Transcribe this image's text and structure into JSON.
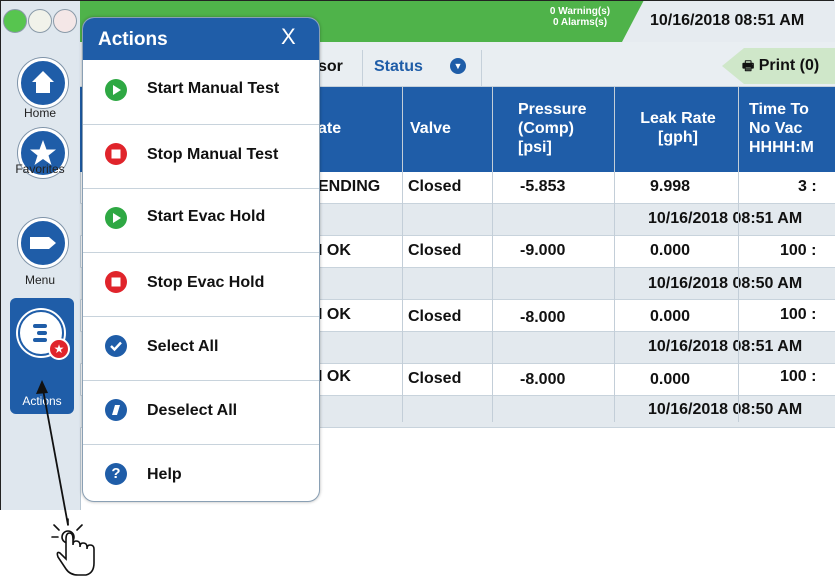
{
  "status": {
    "warnings": "0 Warning(s)",
    "alarms": "0 Alarms(s)",
    "datetime": "10/16/2018 08:51 AM"
  },
  "nav": {
    "home": "Home",
    "favorites": "Favorites",
    "menu": "Menu",
    "actions": "Actions"
  },
  "tabs": {
    "sensor": "sor",
    "status": "Status",
    "print": "Print (0)"
  },
  "table": {
    "headers": {
      "state": "ate",
      "valve": "Valve",
      "pressure": [
        "Pressure",
        "(Comp)",
        "[psi]"
      ],
      "leak_rate": [
        "Leak Rate",
        "[gph]"
      ],
      "time_to_no_vac": [
        "Time To",
        "No Vac",
        "HHHH:M"
      ]
    },
    "rows": [
      {
        "state": "ENDING",
        "valve": "Closed",
        "pressure": "-5.853",
        "leak_rate": "9.998",
        "time": "3 :",
        "timestamp": "10/16/2018 08:51 AM"
      },
      {
        "state": "I OK",
        "valve": "Closed",
        "pressure": "-9.000",
        "leak_rate": "0.000",
        "time": "100 :",
        "timestamp": "10/16/2018 08:50 AM"
      },
      {
        "state": "I OK",
        "valve": "Closed",
        "pressure": "-8.000",
        "leak_rate": "0.000",
        "time": "100 :",
        "timestamp": "10/16/2018 08:51 AM"
      },
      {
        "state": "I OK",
        "valve": "Closed",
        "pressure": "-8.000",
        "leak_rate": "0.000",
        "time": "100 :",
        "timestamp": "10/16/2018 08:50 AM"
      }
    ]
  },
  "actions_panel": {
    "title": "Actions",
    "close": "X",
    "items": [
      {
        "label": "Start Manual Test",
        "icon": "play-icon",
        "color": "#2ea843"
      },
      {
        "label": "Stop Manual Test",
        "icon": "stop-icon",
        "color": "#e0242b"
      },
      {
        "label": "Start Evac Hold",
        "icon": "play-icon",
        "color": "#2ea843"
      },
      {
        "label": "Stop Evac Hold",
        "icon": "stop-icon",
        "color": "#e0242b"
      },
      {
        "label": "Select All",
        "icon": "checkmark-icon",
        "color": "#1f5da8"
      },
      {
        "label": "Deselect All",
        "icon": "slash-icon",
        "color": "#1f5da8"
      },
      {
        "label": "Help",
        "icon": "help-icon",
        "color": "#1f5da8"
      }
    ]
  },
  "colors": {
    "brand_blue": "#1f5da8",
    "status_green": "#4fb34a",
    "stop_red": "#e0242b",
    "start_green": "#2ea843"
  }
}
